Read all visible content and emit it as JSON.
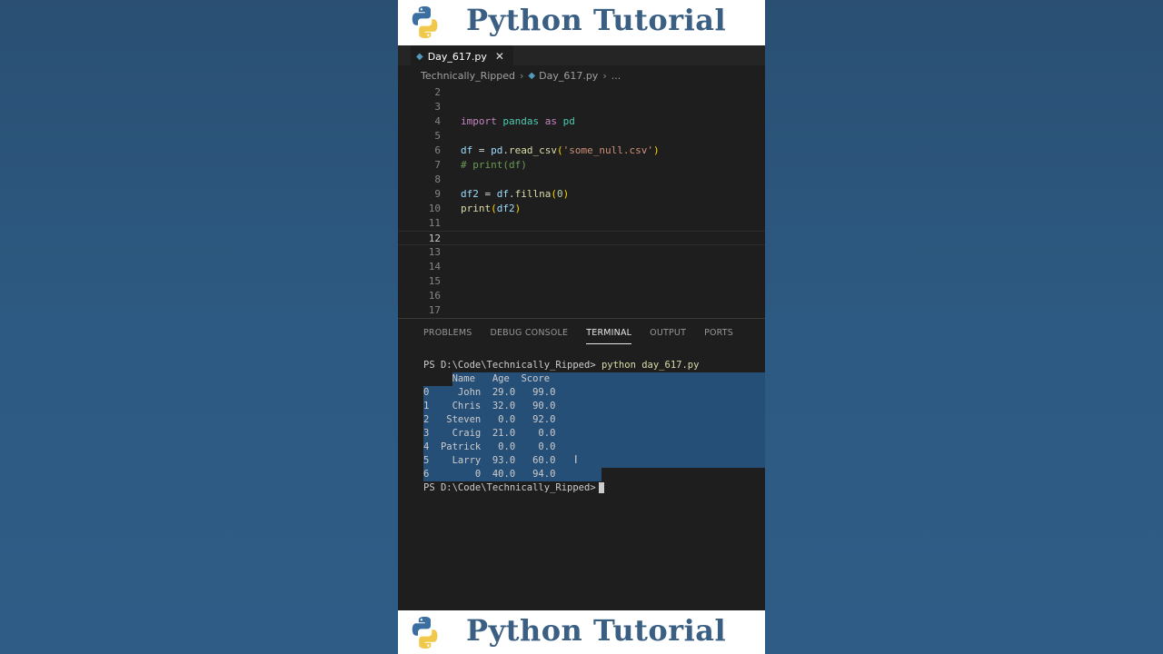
{
  "banner": {
    "title": "Python Tutorial"
  },
  "editor": {
    "tab_name": "Day_617.py",
    "breadcrumb": [
      "Technically_Ripped",
      "Day_617.py",
      "..."
    ],
    "line_numbers": [
      "2",
      "3",
      "4",
      "5",
      "6",
      "7",
      "8",
      "9",
      "10",
      "11",
      "12",
      "13",
      "14",
      "15",
      "16",
      "17"
    ],
    "code": {
      "l4_import": "import",
      "l4_module": "pandas",
      "l4_as": "as",
      "l4_alias": "pd",
      "l6_var": "df",
      "l6_eq": " = ",
      "l6_obj": "pd",
      "l6_dot": ".",
      "l6_fn": "read_csv",
      "l6_open": "(",
      "l6_str": "'some_null.csv'",
      "l6_close": ")",
      "l7_comment": "# print(df)",
      "l9_var": "df2",
      "l9_eq": " = ",
      "l9_obj": "df",
      "l9_dot": ".",
      "l9_fn": "fillna",
      "l9_open": "(",
      "l9_num": "0",
      "l9_close": ")",
      "l10_fn": "print",
      "l10_open": "(",
      "l10_arg": "df2",
      "l10_close": ")"
    }
  },
  "panel": {
    "tabs": [
      "PROBLEMS",
      "DEBUG CONSOLE",
      "TERMINAL",
      "OUTPUT",
      "PORTS"
    ],
    "active_tab": "TERMINAL"
  },
  "terminal": {
    "prompt": "PS D:\\Code\\Technically_Ripped> ",
    "command": "python day_617.py",
    "lines": [
      "     Name   Age  Score",
      "0     John  29.0   99.0",
      "1    Chris  32.0   90.0",
      "2   Steven   0.0   92.0",
      "3    Craig  21.0    0.0",
      "4  Patrick   0.0    0.0",
      "5    Larry  93.0   60.0",
      "6        0  40.0   94.0"
    ],
    "final_prompt": "PS D:\\Code\\Technically_Ripped>"
  },
  "colors": {
    "accent": "#3a5f83",
    "selection": "#264f78",
    "editor_bg": "#1e1e1e"
  }
}
